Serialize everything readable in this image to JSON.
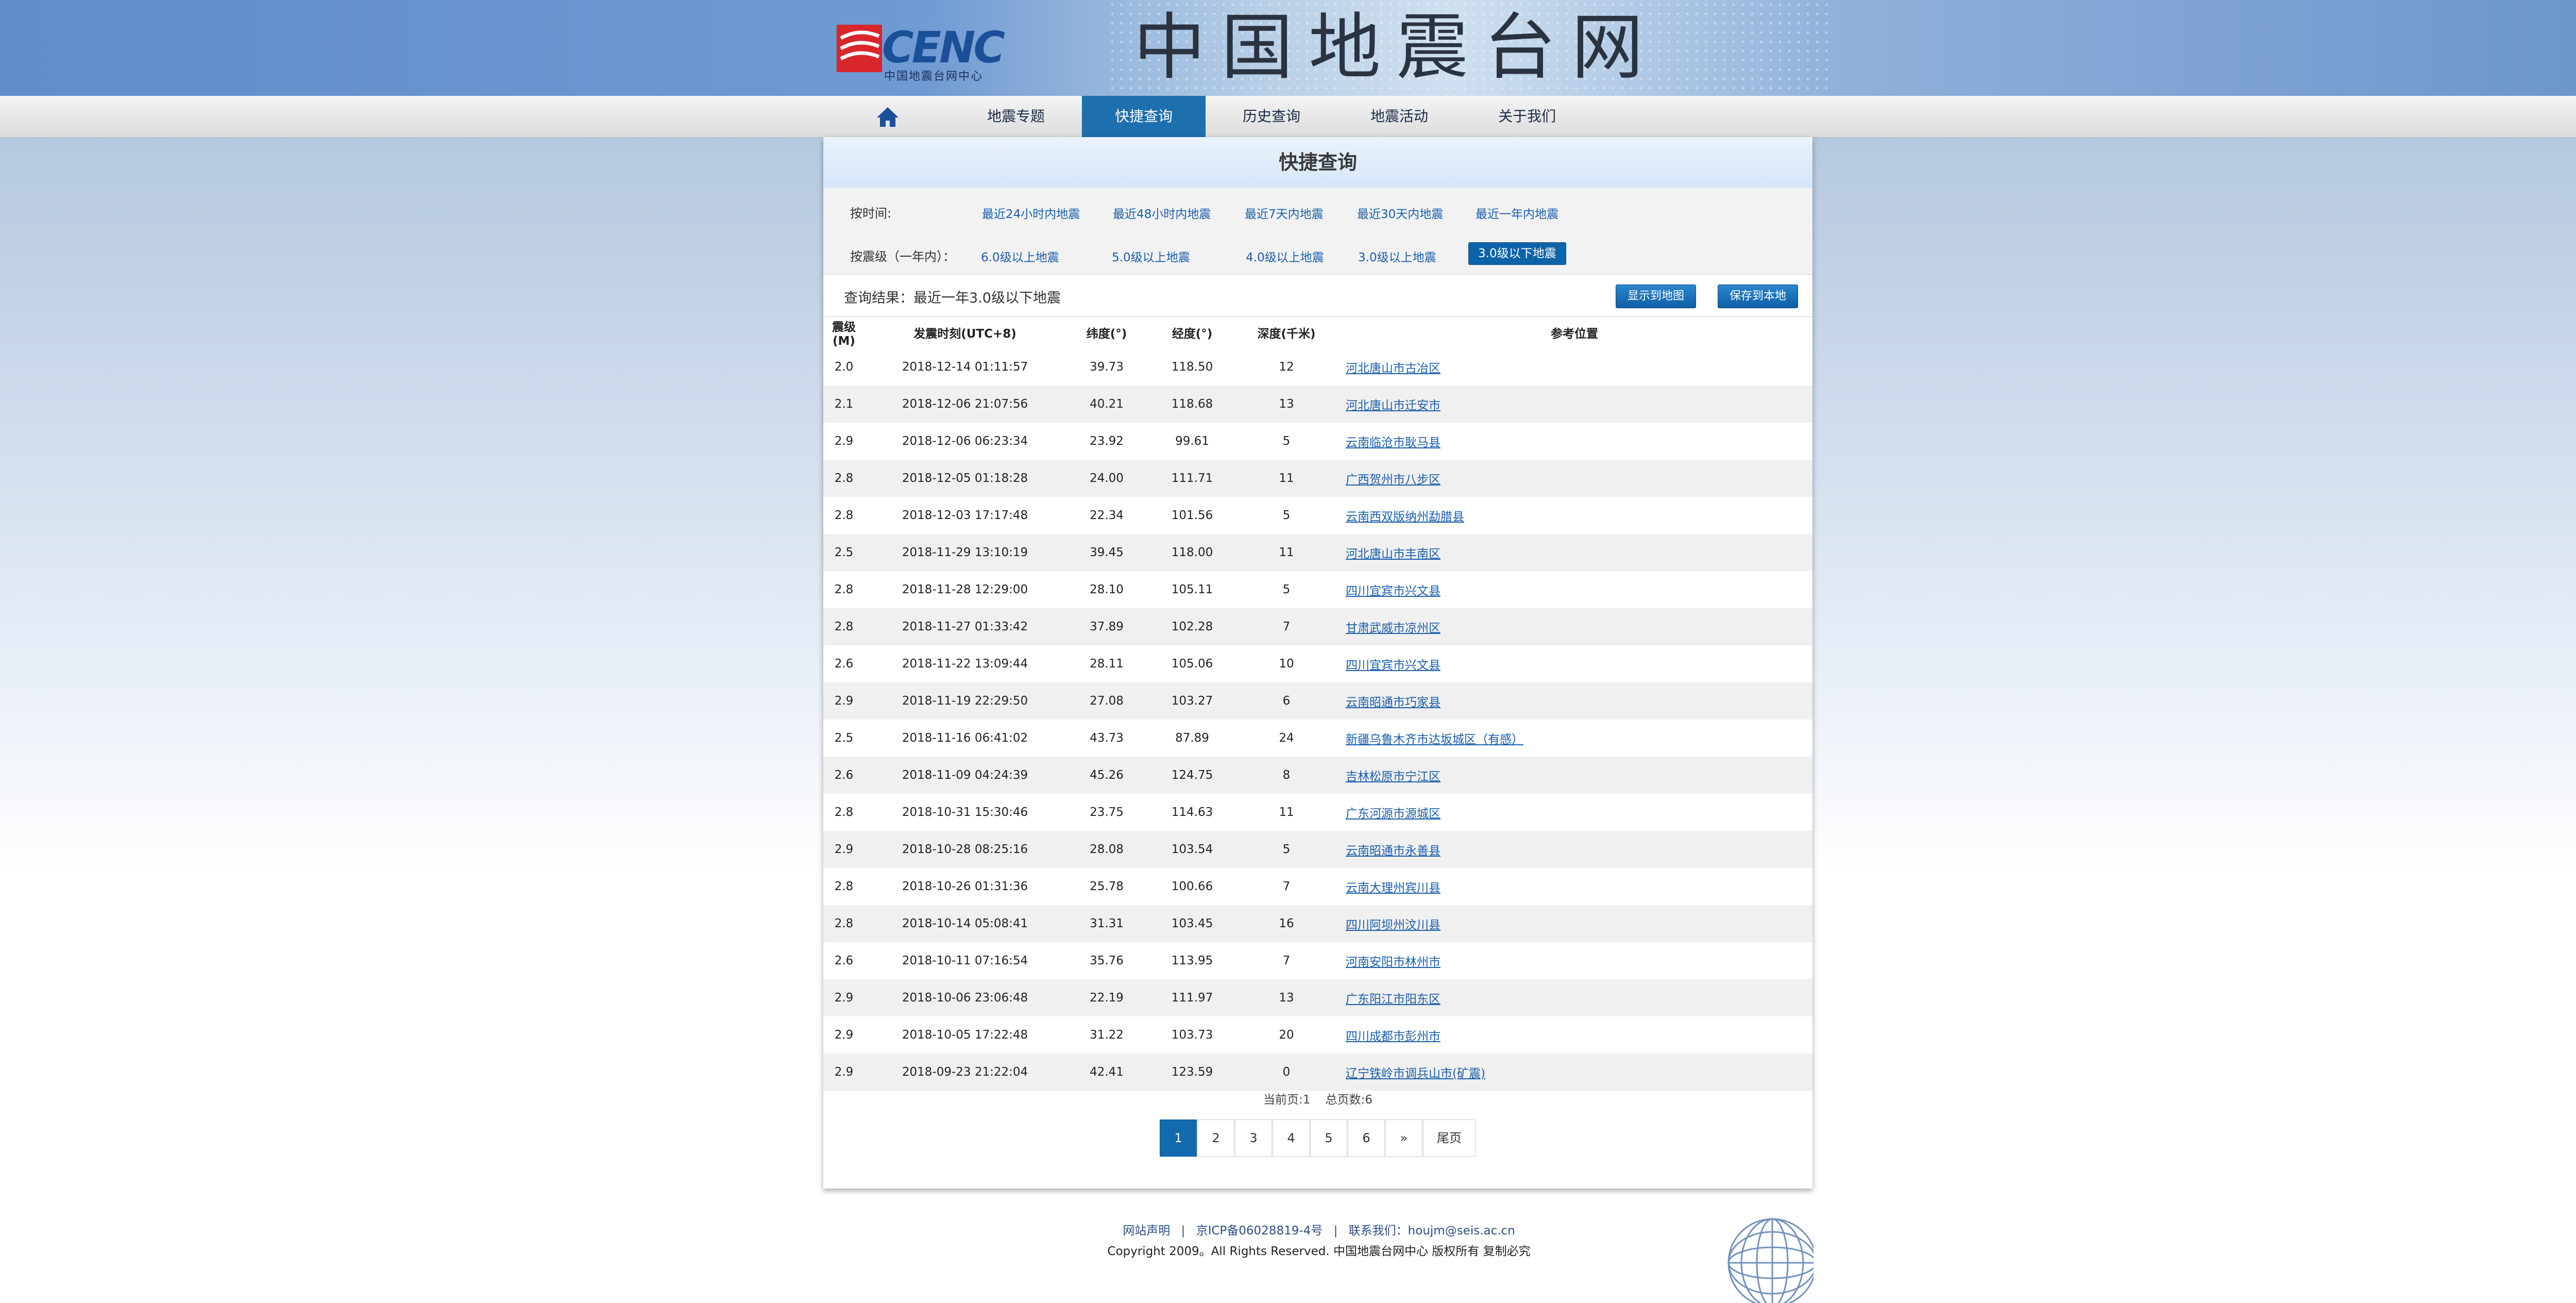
{
  "header": {
    "logo_text": "CENC",
    "logo_subtitle": "中国地震台网中心",
    "site_title": "中国地震台网"
  },
  "nav": {
    "home_icon": "home-icon",
    "items": [
      {
        "label": "地震专题"
      },
      {
        "label": "快捷查询",
        "active": true
      },
      {
        "label": "历史查询"
      },
      {
        "label": "地震活动"
      },
      {
        "label": "关于我们"
      }
    ]
  },
  "panel": {
    "title": "快捷查询",
    "filters": {
      "time_label": "按时间:",
      "time_options": [
        "最近24小时内地震",
        "最近48小时内地震",
        "最近7天内地震",
        "最近30天内地震",
        "最近一年内地震"
      ],
      "mag_label": "按震级（一年内）：",
      "mag_options": [
        "6.0级以上地震",
        "5.0级以上地震",
        "4.0级以上地震",
        "3.0级以上地震"
      ],
      "mag_active": "3.0级以下地震"
    },
    "result_text": "查询结果：最近一年3.0级以下地震",
    "btn_map": "显示到地图",
    "btn_save": "保存到本地"
  },
  "table": {
    "headers": [
      "震级(M)",
      "发震时刻(UTC+8)",
      "纬度(°)",
      "经度(°)",
      "深度(千米)",
      "参考位置"
    ],
    "rows": [
      [
        "2.0",
        "2018-12-14 01:11:57",
        "39.73",
        "118.50",
        "12",
        "河北唐山市古冶区"
      ],
      [
        "2.1",
        "2018-12-06 21:07:56",
        "40.21",
        "118.68",
        "13",
        "河北唐山市迁安市"
      ],
      [
        "2.9",
        "2018-12-06 06:23:34",
        "23.92",
        "99.61",
        "5",
        "云南临沧市耿马县"
      ],
      [
        "2.8",
        "2018-12-05 01:18:28",
        "24.00",
        "111.71",
        "11",
        "广西贺州市八步区"
      ],
      [
        "2.8",
        "2018-12-03 17:17:48",
        "22.34",
        "101.56",
        "5",
        "云南西双版纳州勐腊县"
      ],
      [
        "2.5",
        "2018-11-29 13:10:19",
        "39.45",
        "118.00",
        "11",
        "河北唐山市丰南区"
      ],
      [
        "2.8",
        "2018-11-28 12:29:00",
        "28.10",
        "105.11",
        "5",
        "四川宜宾市兴文县"
      ],
      [
        "2.8",
        "2018-11-27 01:33:42",
        "37.89",
        "102.28",
        "7",
        "甘肃武威市凉州区"
      ],
      [
        "2.6",
        "2018-11-22 13:09:44",
        "28.11",
        "105.06",
        "10",
        "四川宜宾市兴文县"
      ],
      [
        "2.9",
        "2018-11-19 22:29:50",
        "27.08",
        "103.27",
        "6",
        "云南昭通市巧家县"
      ],
      [
        "2.5",
        "2018-11-16 06:41:02",
        "43.73",
        "87.89",
        "24",
        "新疆乌鲁木齐市达坂城区（有感）"
      ],
      [
        "2.6",
        "2018-11-09 04:24:39",
        "45.26",
        "124.75",
        "8",
        "吉林松原市宁江区"
      ],
      [
        "2.8",
        "2018-10-31 15:30:46",
        "23.75",
        "114.63",
        "11",
        "广东河源市源城区"
      ],
      [
        "2.9",
        "2018-10-28 08:25:16",
        "28.08",
        "103.54",
        "5",
        "云南昭通市永善县"
      ],
      [
        "2.8",
        "2018-10-26 01:31:36",
        "25.78",
        "100.66",
        "7",
        "云南大理州宾川县"
      ],
      [
        "2.8",
        "2018-10-14 05:08:41",
        "31.31",
        "103.45",
        "16",
        "四川阿坝州汶川县"
      ],
      [
        "2.6",
        "2018-10-11 07:16:54",
        "35.76",
        "113.95",
        "7",
        "河南安阳市林州市"
      ],
      [
        "2.9",
        "2018-10-06 23:06:48",
        "22.19",
        "111.97",
        "13",
        "广东阳江市阳东区"
      ],
      [
        "2.9",
        "2018-10-05 17:22:48",
        "31.22",
        "103.73",
        "20",
        "四川成都市彭州市"
      ],
      [
        "2.9",
        "2018-09-23 21:22:04",
        "42.41",
        "123.59",
        "0",
        "辽宁铁岭市调兵山市(矿震)"
      ]
    ]
  },
  "pagination": {
    "info": "当前页:1    总页数:6",
    "pages": [
      "1",
      "2",
      "3",
      "4",
      "5",
      "6",
      "»",
      "尾页"
    ],
    "current": "1"
  },
  "footer": {
    "line1": [
      "网站声明",
      "京ICP备06028819-4号",
      "联系我们：houjm@seis.ac.cn"
    ],
    "separator": "|",
    "line2": "Copyright 2009。All Rights Reserved. 中国地震台网中心 版权所有 复制必究",
    "globe_icon": "globe-icon"
  },
  "colors": {
    "nav_active": "#1e6fae",
    "link": "#1b5fae",
    "button": "#0d63a8"
  }
}
